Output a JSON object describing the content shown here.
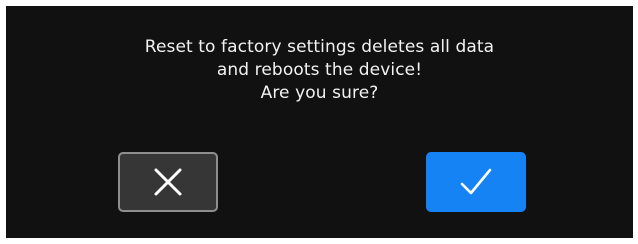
{
  "dialog": {
    "message_lines": [
      "Reset to factory settings deletes all data",
      "and reboots the device!",
      "Are you sure?"
    ],
    "cancel_icon": "close-icon",
    "confirm_icon": "checkmark-icon"
  },
  "colors": {
    "background": "#111111",
    "text": "#f2f2f2",
    "cancel_button": "#363636",
    "cancel_border": "#8e8e8e",
    "confirm_button": "#1683f5"
  }
}
